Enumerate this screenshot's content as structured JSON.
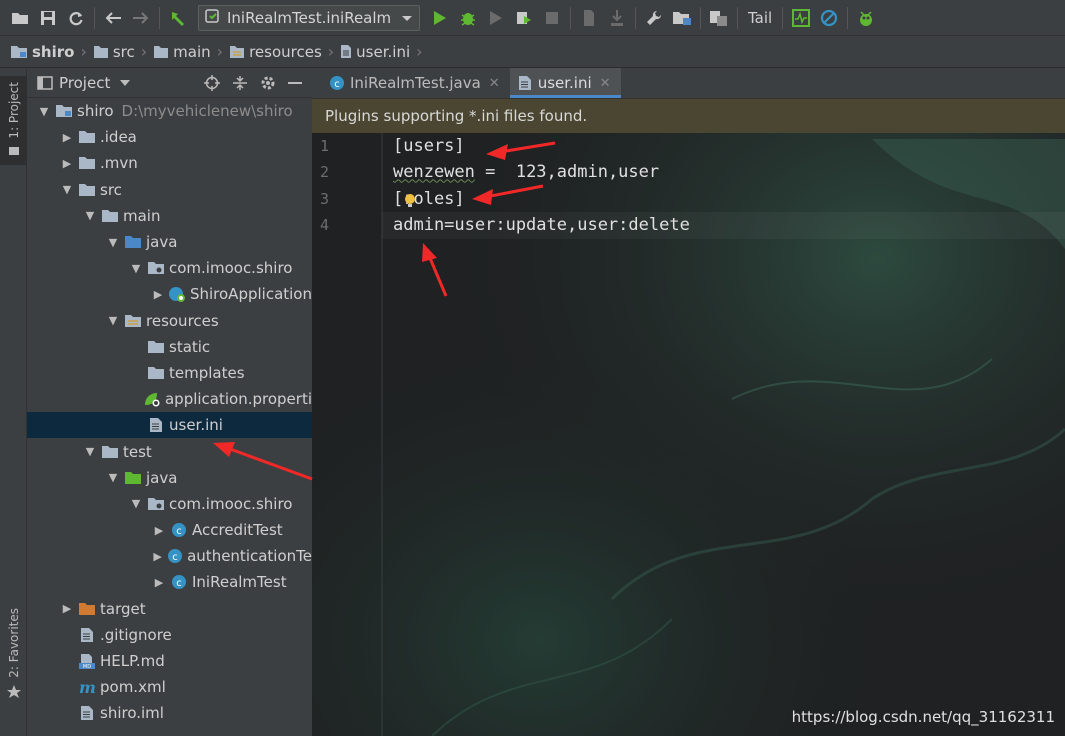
{
  "toolbar": {
    "run_config": "IniRealmTest.iniRealm",
    "tail": "Tail"
  },
  "breadcrumb": [
    "shiro",
    "src",
    "main",
    "resources",
    "user.ini"
  ],
  "side_tabs": {
    "project": "1: Project",
    "favorites": "2: Favorites"
  },
  "project_panel": {
    "title": "Project",
    "tree": [
      {
        "label": "shiro",
        "path": "D:\\myvehiclenew\\shiro",
        "depth": 0,
        "arrow": "down",
        "icon": "module-folder-icon"
      },
      {
        "label": ".idea",
        "depth": 1,
        "arrow": "right",
        "icon": "folder-icon"
      },
      {
        "label": ".mvn",
        "depth": 1,
        "arrow": "right",
        "icon": "folder-icon"
      },
      {
        "label": "src",
        "depth": 1,
        "arrow": "down",
        "icon": "folder-icon"
      },
      {
        "label": "main",
        "depth": 2,
        "arrow": "down",
        "icon": "folder-icon"
      },
      {
        "label": "java",
        "depth": 3,
        "arrow": "down",
        "icon": "source-folder-icon"
      },
      {
        "label": "com.imooc.shiro",
        "depth": 4,
        "arrow": "down",
        "icon": "package-icon"
      },
      {
        "label": "ShiroApplication",
        "depth": 5,
        "arrow": "right",
        "icon": "spring-class-icon"
      },
      {
        "label": "resources",
        "depth": 3,
        "arrow": "down",
        "icon": "resources-folder-icon"
      },
      {
        "label": "static",
        "depth": 4,
        "arrow": "none",
        "icon": "folder-icon"
      },
      {
        "label": "templates",
        "depth": 4,
        "arrow": "none",
        "icon": "folder-icon"
      },
      {
        "label": "application.properti",
        "depth": 4,
        "arrow": "none",
        "icon": "spring-config-icon"
      },
      {
        "label": "user.ini",
        "depth": 4,
        "arrow": "none",
        "icon": "text-file-icon",
        "selected": true
      },
      {
        "label": "test",
        "depth": 2,
        "arrow": "down",
        "icon": "folder-icon"
      },
      {
        "label": "java",
        "depth": 3,
        "arrow": "down",
        "icon": "test-folder-icon"
      },
      {
        "label": "com.imooc.shiro",
        "depth": 4,
        "arrow": "down",
        "icon": "package-icon"
      },
      {
        "label": "AccreditTest",
        "depth": 5,
        "arrow": "right",
        "icon": "class-icon"
      },
      {
        "label": "authenticationTe",
        "depth": 5,
        "arrow": "right",
        "icon": "class-icon"
      },
      {
        "label": "IniRealmTest",
        "depth": 5,
        "arrow": "right",
        "icon": "class-icon"
      },
      {
        "label": "target",
        "depth": 1,
        "arrow": "right",
        "icon": "excluded-folder-icon"
      },
      {
        "label": ".gitignore",
        "depth": 1,
        "arrow": "none",
        "icon": "text-file-icon"
      },
      {
        "label": "HELP.md",
        "depth": 1,
        "arrow": "none",
        "icon": "markdown-icon"
      },
      {
        "label": "pom.xml",
        "depth": 1,
        "arrow": "none",
        "icon": "maven-icon"
      },
      {
        "label": "shiro.iml",
        "depth": 1,
        "arrow": "none",
        "icon": "text-file-icon"
      }
    ]
  },
  "editor_tabs": [
    {
      "label": "IniRealmTest.java",
      "active": false,
      "icon": "class-icon"
    },
    {
      "label": "user.ini",
      "active": true,
      "icon": "text-file-icon"
    }
  ],
  "editor": {
    "banner": "Plugins supporting *.ini files found.",
    "lines": [
      {
        "num": "1",
        "text": "[users]"
      },
      {
        "num": "2",
        "text": "wenzewen =  123,admin,user"
      },
      {
        "num": "3",
        "text": "[roles]"
      },
      {
        "num": "4",
        "text": "admin=user:update,user:delete"
      }
    ]
  },
  "watermark": "https://blog.csdn.net/qq_31162311",
  "colors": {
    "accent": "#4a88c7",
    "annotation": "#f02828",
    "selection": "#0d293e",
    "banner": "#4a4631"
  }
}
